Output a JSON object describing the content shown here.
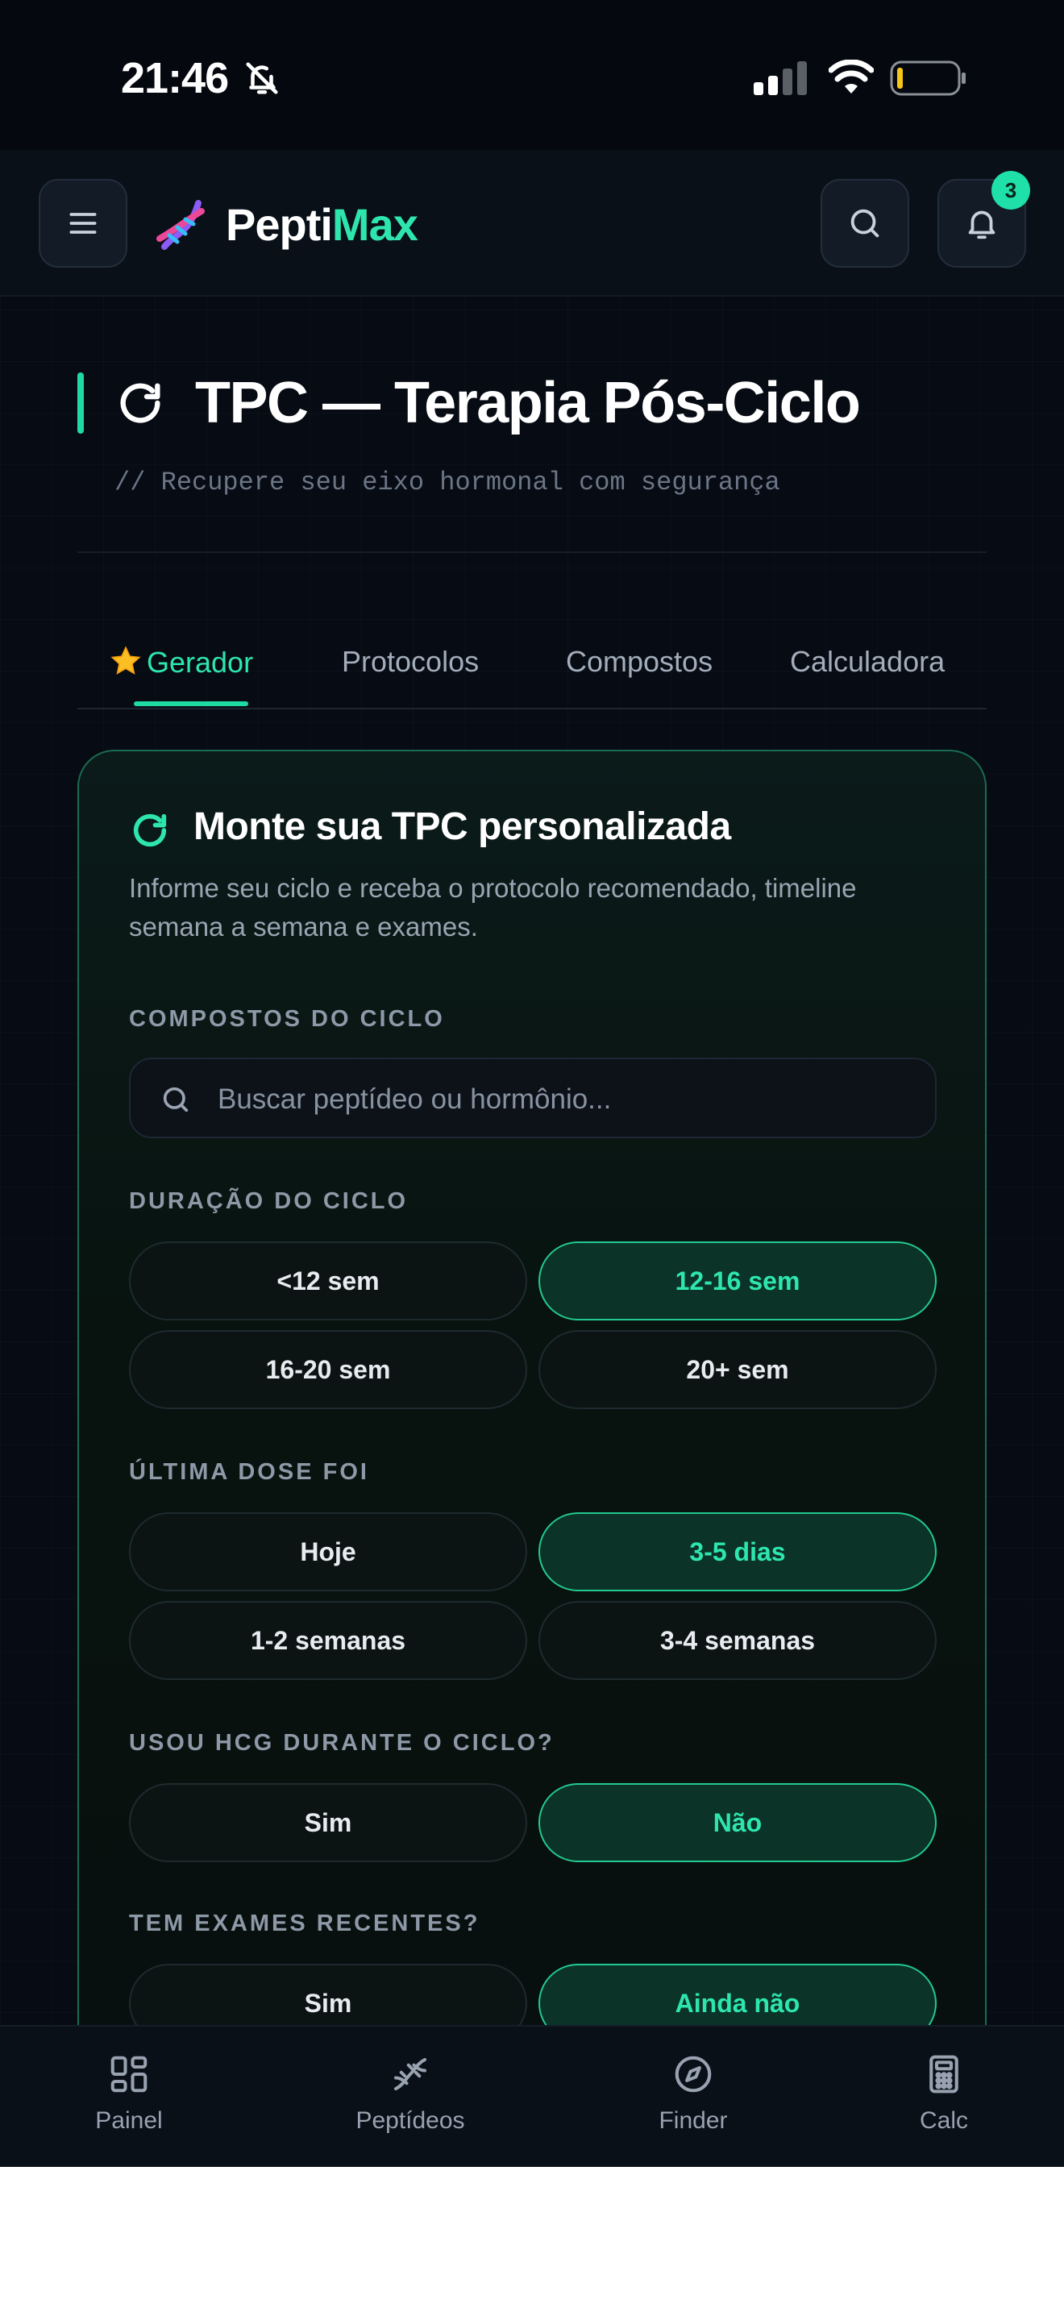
{
  "status_bar": {
    "time": "21:46"
  },
  "header": {
    "brand_part1": "Pepti",
    "brand_part2": "Max",
    "notification_count": "3"
  },
  "page": {
    "title": "TPC — Terapia Pós-Ciclo",
    "subtitle": "// Recupere seu eixo hormonal com segurança"
  },
  "tabs": [
    {
      "label": "Gerador",
      "icon": "star-icon",
      "active": true
    },
    {
      "label": "Protocolos",
      "active": false
    },
    {
      "label": "Compostos",
      "active": false
    },
    {
      "label": "Calculadora",
      "active": false
    }
  ],
  "card": {
    "title": "Monte sua TPC personalizada",
    "description": "Informe seu ciclo e receba o protocolo recomendado, timeline semana a semana e exames."
  },
  "compounds": {
    "label": "COMPOSTOS DO CICLO",
    "placeholder": "Buscar peptídeo ou hormônio...",
    "value": ""
  },
  "duration": {
    "label": "DURAÇÃO DO CICLO",
    "options": [
      "<12 sem",
      "12-16 sem",
      "16-20 sem",
      "20+ sem"
    ],
    "selected": "12-16 sem"
  },
  "last_dose": {
    "label": "ÚLTIMA DOSE FOI",
    "options": [
      "Hoje",
      "3-5 dias",
      "1-2 semanas",
      "3-4 semanas"
    ],
    "selected": "3-5 dias"
  },
  "hcg": {
    "label": "USOU HCG DURANTE O CICLO?",
    "options": [
      "Sim",
      "Não"
    ],
    "selected": "Não"
  },
  "exams": {
    "label": "TEM EXAMES RECENTES?",
    "options": [
      "Sim",
      "Ainda não"
    ],
    "selected": "Ainda não"
  },
  "bottom_nav": [
    {
      "label": "Painel",
      "icon": "grid-icon"
    },
    {
      "label": "Peptídeos",
      "icon": "dna-icon"
    },
    {
      "label": "Finder",
      "icon": "compass-icon"
    },
    {
      "label": "Calc",
      "icon": "calculator-icon"
    }
  ],
  "colors": {
    "accent": "#2ee6ad",
    "background": "#070b13",
    "card_border": "#1a6b52"
  }
}
